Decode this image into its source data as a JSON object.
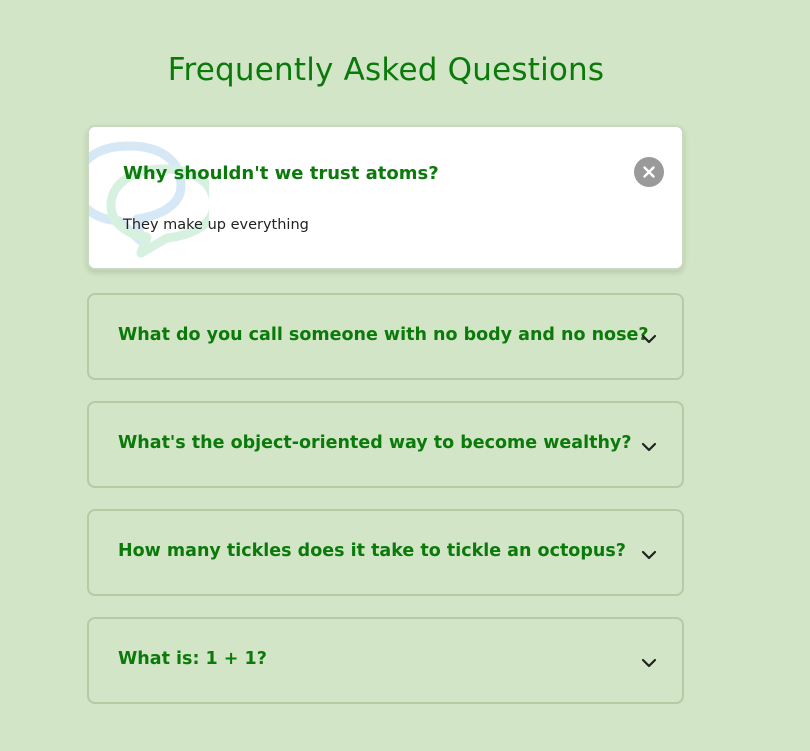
{
  "page": {
    "title": "Frequently Asked Questions"
  },
  "faqs": [
    {
      "question": "Why shouldn't we trust atoms?",
      "answer": "They make up everything",
      "expanded": true
    },
    {
      "question": "What do you call someone with no body and no nose?",
      "expanded": false
    },
    {
      "question": "What's the object-oriented way to become wealthy?",
      "expanded": false
    },
    {
      "question": "How many tickles does it take to tickle an octopus?",
      "expanded": false
    },
    {
      "question": "What is: 1 + 1?",
      "expanded": false
    }
  ],
  "icons": {
    "close": "close-icon",
    "chevron": "chevron-down-icon",
    "decoration": "chat-bubbles-icon"
  },
  "colors": {
    "background": "#d2e5c6",
    "accent_green": "#0b7a0b",
    "card_border": "#b3cca3",
    "close_button": "#9a9a9a",
    "bubble_blue": "#d6e8f6",
    "bubble_green": "#d6f1df"
  }
}
